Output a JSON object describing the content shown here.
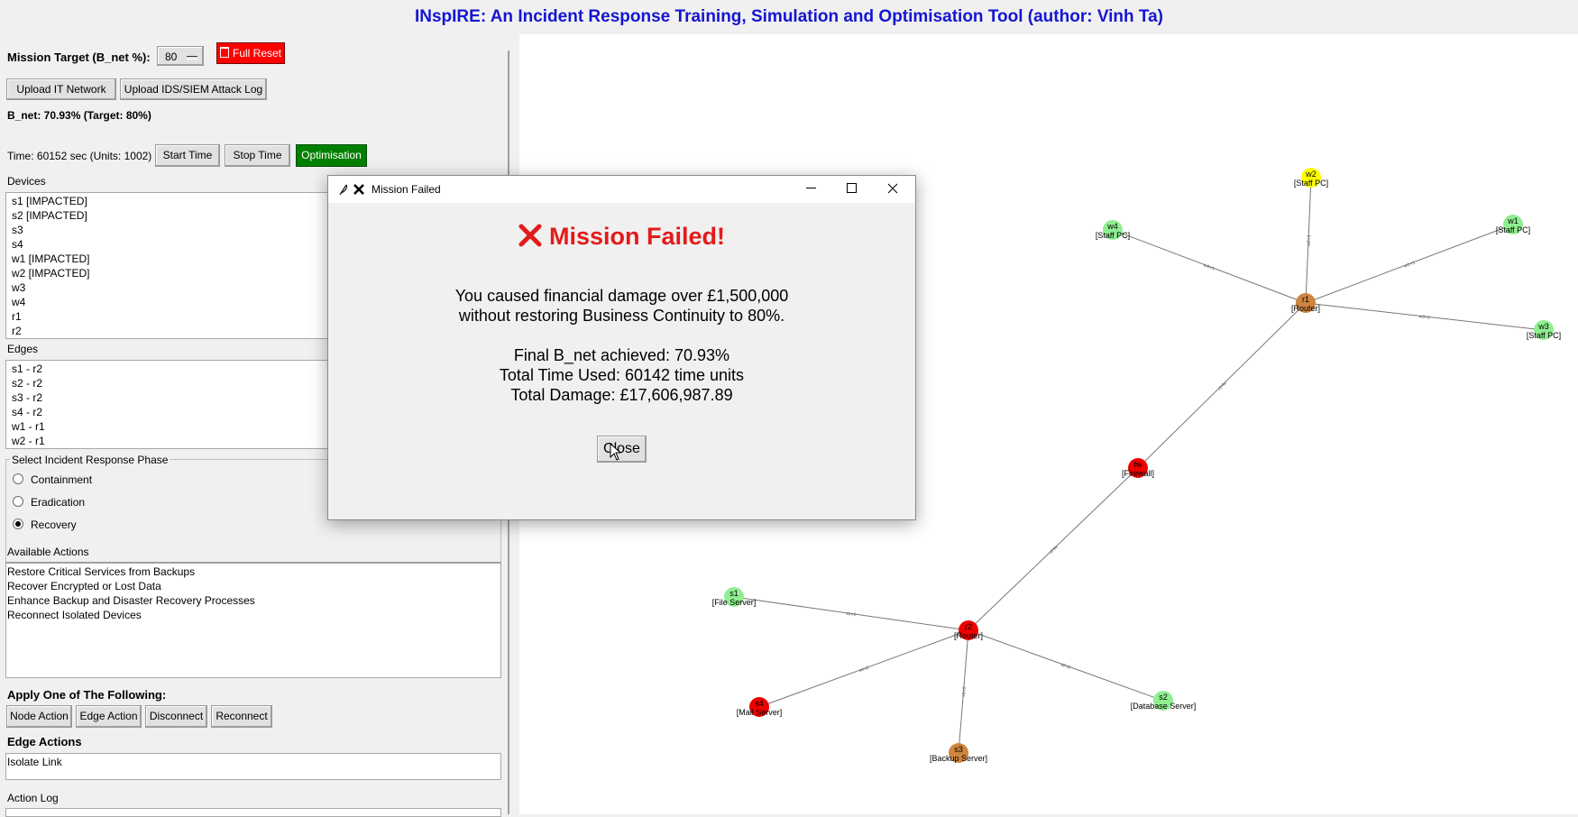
{
  "app": {
    "title": "INspIRE: An Incident Response Training, Simulation and Optimisation Tool (author: Vinh Ta)"
  },
  "controls": {
    "mission_target_label": "Mission Target (B_net %):",
    "mission_target_value": "80",
    "full_reset_label": "Full Reset",
    "upload_network_label": "Upload IT Network",
    "upload_log_label": "Upload IDS/SIEM Attack Log",
    "bnet_status": "B_net: 70.93% (Target: 80%)",
    "time_status": "Time: 60152 sec (Units: 1002)",
    "start_time_label": "Start Time",
    "stop_time_label": "Stop Time",
    "optimisation_label": "Optimisation"
  },
  "devices": {
    "label": "Devices",
    "items": [
      "s1 [IMPACTED]",
      "s2 [IMPACTED]",
      "s3",
      "s4",
      "w1 [IMPACTED]",
      "w2 [IMPACTED]",
      "w3",
      "w4",
      "r1",
      "r2"
    ]
  },
  "edges": {
    "label": "Edges",
    "items": [
      "s1 - r2",
      "s2 - r2",
      "s3 - r2",
      "s4 - r2",
      "w1 - r1",
      "w2 - r1"
    ]
  },
  "phase": {
    "label": "Select Incident Response Phase",
    "options": [
      "Containment",
      "Eradication",
      "Recovery"
    ],
    "selected": "Recovery"
  },
  "actions": {
    "label": "Available Actions",
    "items": [
      "Restore Critical Services from Backups",
      "Recover Encrypted or Lost Data",
      "Enhance Backup and Disaster Recovery Processes",
      "Reconnect Isolated Devices"
    ]
  },
  "apply": {
    "label": "Apply One of The Following:",
    "node_action": "Node Action",
    "edge_action": "Edge Action",
    "disconnect": "Disconnect",
    "reconnect": "Reconnect"
  },
  "edge_actions": {
    "label": "Edge Actions",
    "items": [
      "Isolate Link"
    ]
  },
  "action_log": {
    "label": "Action Log"
  },
  "network": {
    "nodes": [
      {
        "id": "w2",
        "role": "[Staff PC]",
        "color": "#ffff00"
      },
      {
        "id": "w4",
        "role": "[Staff PC]",
        "color": "#90ee90"
      },
      {
        "id": "w1",
        "role": "[Staff PC]",
        "color": "#90ee90"
      },
      {
        "id": "r1",
        "role": "[Router]",
        "color": "#cd853f"
      },
      {
        "id": "w3",
        "role": "[Staff PC]",
        "color": "#90ee90"
      },
      {
        "id": "fw",
        "role": "[Firewall]",
        "color": "#ee0000"
      },
      {
        "id": "s1",
        "role": "[File Server]",
        "color": "#90ee90"
      },
      {
        "id": "r2",
        "role": "[Router]",
        "color": "#ee0000"
      },
      {
        "id": "s4",
        "role": "[Mail Server]",
        "color": "#ee0000"
      },
      {
        "id": "s2",
        "role": "[Database Server]",
        "color": "#90ee90"
      },
      {
        "id": "s3",
        "role": "[Backup Server]",
        "color": "#cd853f"
      }
    ],
    "links": [
      {
        "a": "w2",
        "b": "r1",
        "label": "w2-r1"
      },
      {
        "a": "w4",
        "b": "r1",
        "label": "w4-r1"
      },
      {
        "a": "w1",
        "b": "r1",
        "label": "w1-r1"
      },
      {
        "a": "w3",
        "b": "r1",
        "label": "w3-r1"
      },
      {
        "a": "r1",
        "b": "fw",
        "label": "r1-fw"
      },
      {
        "a": "fw",
        "b": "r2",
        "label": "r2-fw"
      },
      {
        "a": "s1",
        "b": "r2",
        "label": "s1-r2"
      },
      {
        "a": "s4",
        "b": "r2",
        "label": "s4-r2"
      },
      {
        "a": "s2",
        "b": "r2",
        "label": "s2-r2"
      },
      {
        "a": "s3",
        "b": "r2",
        "label": "s3-r2"
      }
    ]
  },
  "dialog": {
    "title": "Mission Failed",
    "heading": "Mission Failed!",
    "line1": "You caused financial damage over £1,500,000",
    "line2": "without restoring Business Continuity to 80%.",
    "final_bnet": "Final B_net achieved: 70.93%",
    "time_used": "Total Time Used: 60142 time units",
    "damage": "Total Damage: £17,606,987.89",
    "close_label": "Close",
    "icon_color": "#e31b1b"
  }
}
